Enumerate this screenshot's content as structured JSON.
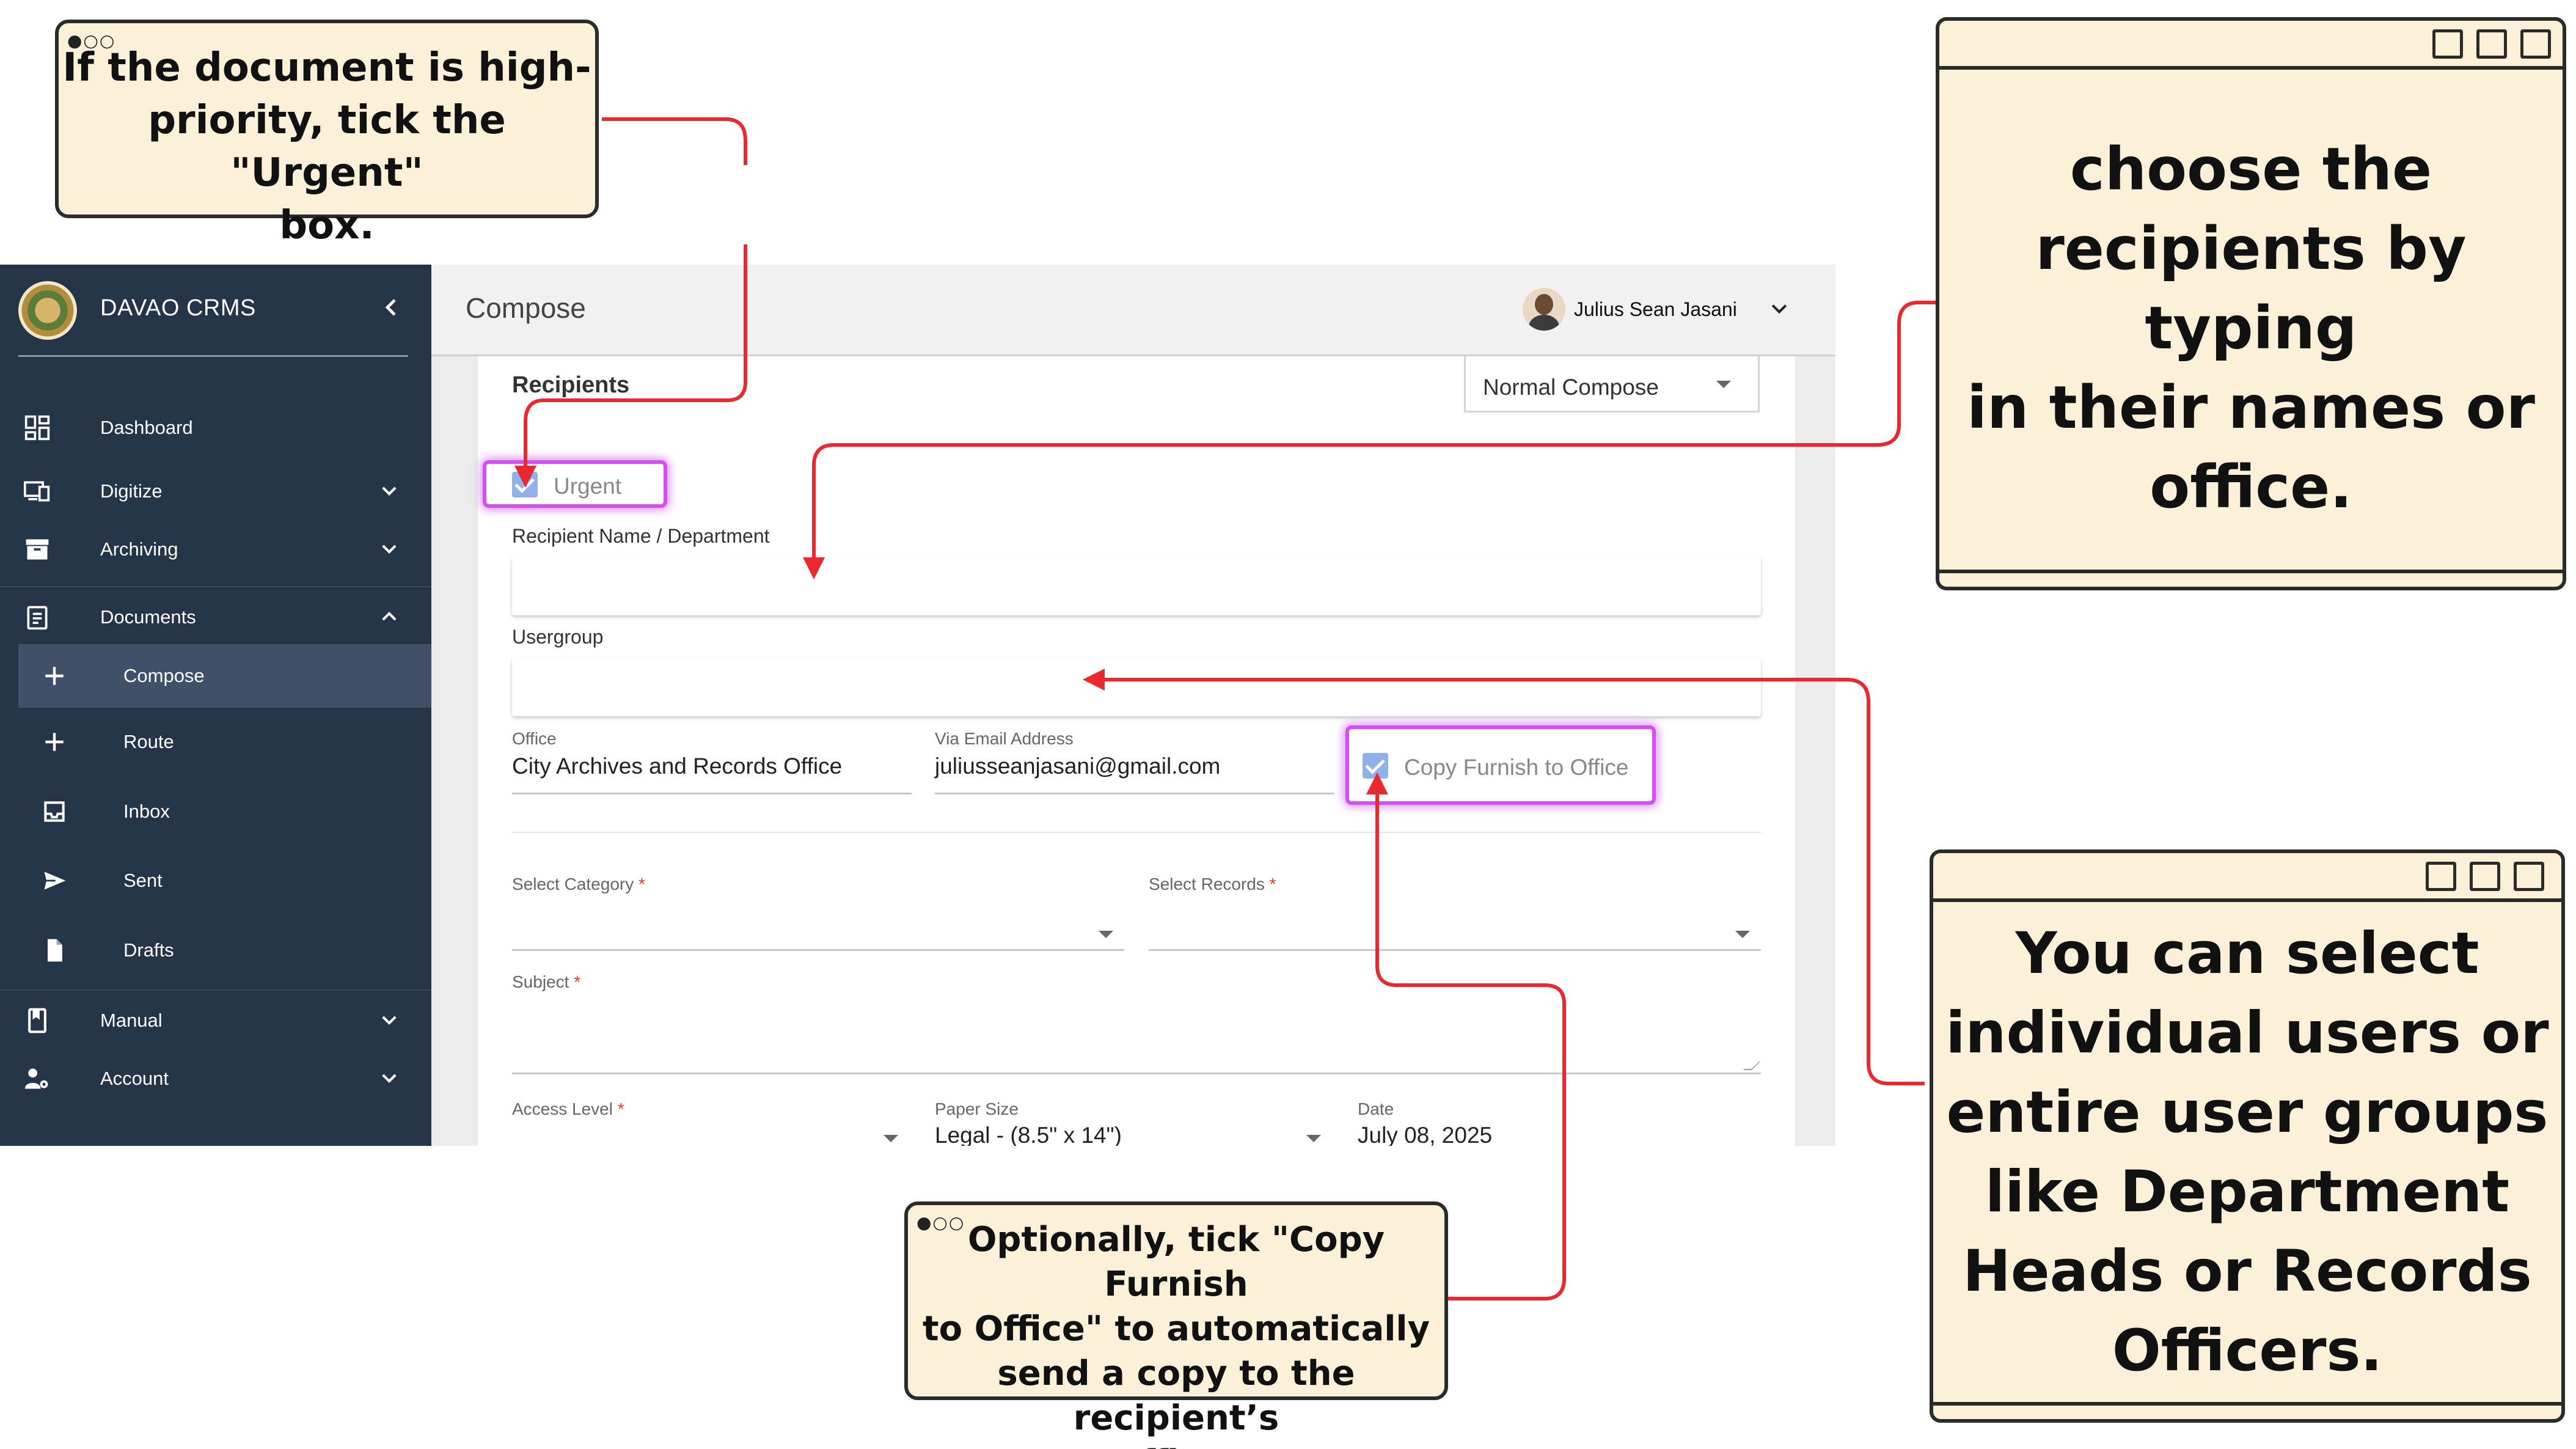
{
  "sidebar": {
    "brand": "DAVAO CRMS",
    "items": [
      {
        "label": "Dashboard"
      },
      {
        "label": "Digitize"
      },
      {
        "label": "Archiving"
      },
      {
        "label": "Documents"
      },
      {
        "label": "Compose"
      },
      {
        "label": "Route"
      },
      {
        "label": "Inbox"
      },
      {
        "label": "Sent"
      },
      {
        "label": "Drafts"
      },
      {
        "label": "Manual"
      },
      {
        "label": "Account"
      }
    ]
  },
  "header": {
    "title": "Compose",
    "user_name": "Julius Sean Jasani"
  },
  "form": {
    "section_title": "Recipients",
    "compose_mode": "Normal Compose",
    "urgent_label": "Urgent",
    "urgent_checked": true,
    "recipient_label": "Recipient Name / Department",
    "usergroup_label": "Usergroup",
    "office_label": "Office",
    "office_value": "City Archives and Records Office",
    "email_label": "Via Email Address",
    "email_value": "juliusseanjasani@gmail.com",
    "copy_furnish_label": "Copy Furnish to Office",
    "copy_furnish_checked": true,
    "category_label": "Select Category",
    "records_label": "Select Records",
    "subject_label": "Subject",
    "access_label": "Access Level",
    "paper_label": "Paper Size",
    "paper_value": "Legal - (8.5\" x 14\")",
    "date_label": "Date",
    "date_value": "July 08, 2025",
    "required_mark": "*"
  },
  "annotations": {
    "urgent_note": [
      "If the document is high-",
      "priority, tick the \"Urgent\"",
      "box."
    ],
    "recipients_note": [
      "choose the",
      "recipients by typing",
      "in their names or",
      "office."
    ],
    "copy_note": [
      "Optionally, tick \"Copy Furnish",
      "to Office\" to automatically",
      "send a copy to the recipient’s",
      "office."
    ],
    "groups_note": [
      "You can select",
      "individual users or",
      "entire user groups",
      "like Department",
      "Heads or Records",
      "Officers."
    ]
  },
  "colors": {
    "sidebar_bg": "#263447",
    "highlight": "#d24ff2",
    "arrow": "#e8292f",
    "note_bg": "#fcf0d8"
  }
}
